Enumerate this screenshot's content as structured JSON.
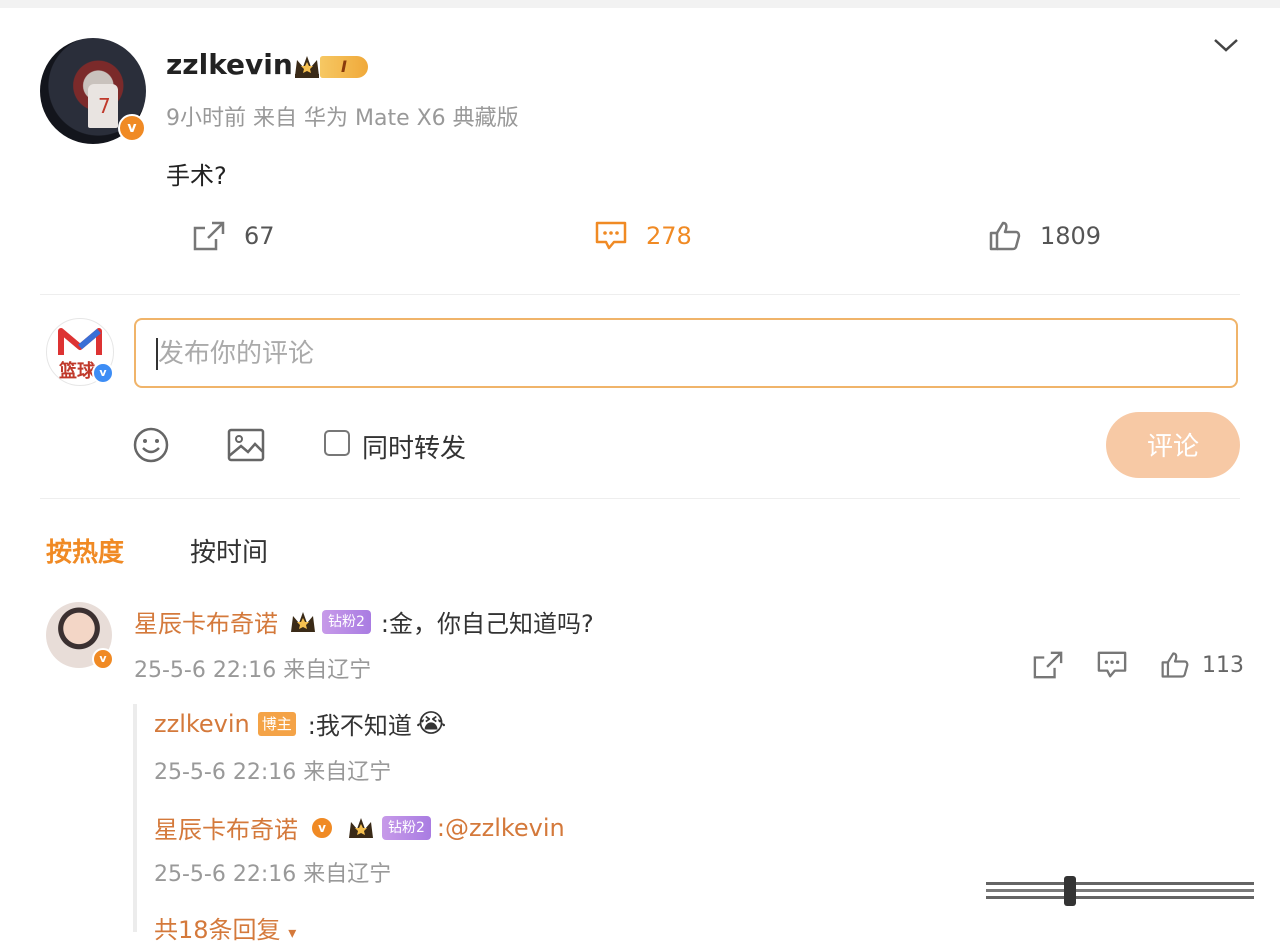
{
  "post": {
    "username": "zzlkevin",
    "level_badge": "I",
    "time": "9小时前",
    "source": "来自 华为 Mate X6 典藏版",
    "text": "手术?",
    "repost_count": "67",
    "comment_count": "278",
    "like_count": "1809",
    "avatar_jersey_number": "7"
  },
  "composer": {
    "placeholder": "发布你的评论",
    "repost_label": "同时转发",
    "submit_label": "评论",
    "avatar_label": "篮球"
  },
  "sort_tabs": [
    "按热度",
    "按时间"
  ],
  "comment": {
    "name": "星辰卡布奇诺",
    "fan_badge": "钻粉2",
    "text": ":金，你自己知道吗?",
    "meta": "25-5-6 22:16 来自辽宁",
    "like_count": "113",
    "replies": [
      {
        "name": "zzlkevin",
        "role_badge": "博主",
        "text": ":我不知道",
        "emoji": "😭",
        "meta": "25-5-6 22:16 来自辽宁"
      },
      {
        "name": "星辰卡布奇诺",
        "fan_badge": "钻粉2",
        "text": ":@zzlkevin",
        "meta": "25-5-6 22:16 来自辽宁"
      }
    ],
    "more_replies": "共18条回复"
  },
  "colors": {
    "accent": "#f08a24",
    "name_orange": "#d4793b",
    "submit_disabled": "#f7c9a5",
    "fan_purple": "#b58ae6"
  }
}
